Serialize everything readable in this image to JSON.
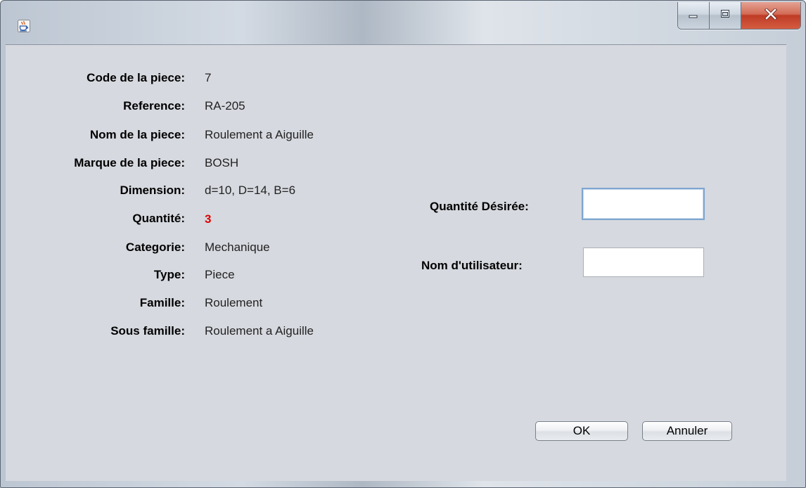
{
  "window": {
    "icon": "java-coffee-cup-icon",
    "controls": {
      "minimize_icon": "minimize-icon",
      "maximize_icon": "maximize-icon",
      "close_icon": "close-icon"
    },
    "accent_close": "#c8432b",
    "client_background": "#d6d9df"
  },
  "details": [
    {
      "label": "Code de la piece:",
      "value": "7"
    },
    {
      "label": "Reference:",
      "value": "RA-205"
    },
    {
      "label": "Nom de la piece:",
      "value": "Roulement a Aiguille"
    },
    {
      "label": "Marque de la piece:",
      "value": "BOSH"
    },
    {
      "label": "Dimension:",
      "value": "d=10, D=14, B=6"
    },
    {
      "label": "Quantité:",
      "value": "3",
      "color": "#e00000"
    },
    {
      "label": "Categorie:",
      "value": "Mechanique"
    },
    {
      "label": "Type:",
      "value": "Piece"
    },
    {
      "label": "Famille:",
      "value": "Roulement"
    },
    {
      "label": "Sous famille:",
      "value": "Roulement a Aiguille"
    }
  ],
  "form": {
    "quantity_label": "Quantité Désirée:",
    "quantity_value": "",
    "username_label": "Nom d'utilisateur:",
    "username_value": ""
  },
  "buttons": {
    "ok": "OK",
    "cancel": "Annuler"
  }
}
